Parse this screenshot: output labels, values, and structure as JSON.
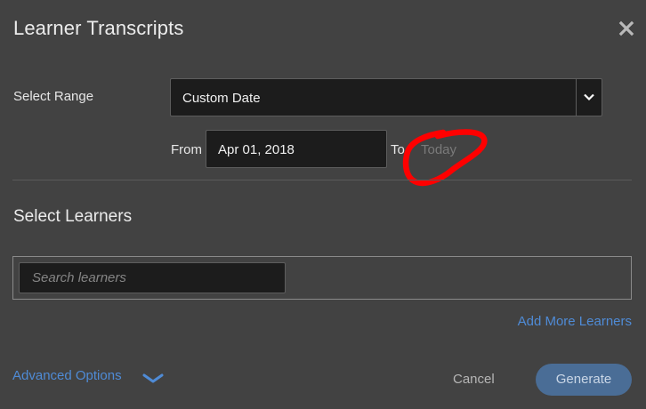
{
  "dialog": {
    "title": "Learner Transcripts",
    "close_icon": "close-icon"
  },
  "range": {
    "label": "Select Range",
    "selected": "Custom Date",
    "toggle_icon": "chevron-down-icon",
    "from_label": "From",
    "from_value": "Apr 01, 2018",
    "to_label": "To",
    "to_value": "Today"
  },
  "learners": {
    "section_title": "Select Learners",
    "search_placeholder": "Search learners",
    "search_value": "",
    "add_more_label": "Add More Learners"
  },
  "footer": {
    "advanced_label": "Advanced Options",
    "advanced_icon": "chevron-down-icon",
    "cancel_label": "Cancel",
    "generate_label": "Generate"
  },
  "colors": {
    "background": "#424242",
    "field_background": "#1c1c1c",
    "link": "#4f8bd6",
    "primary_button": "#4a6d96",
    "annotation": "#ff0000"
  }
}
